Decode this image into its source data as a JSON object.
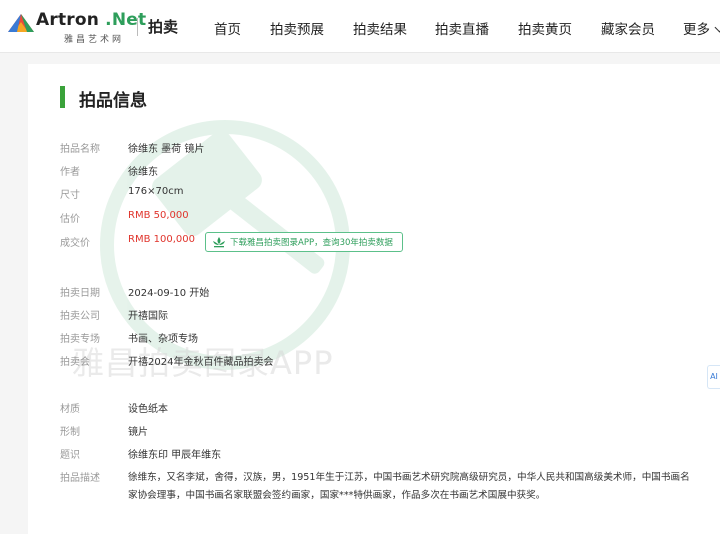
{
  "brand": {
    "name_prefix": "Artron",
    "name_suffix": ".Net",
    "sub": "雅昌艺术网",
    "accent": "#2e9e5b"
  },
  "section": "拍卖",
  "nav": [
    "首页",
    "拍卖预展",
    "拍卖结果",
    "拍卖直播",
    "拍卖黄页",
    "藏家会员",
    "更多"
  ],
  "heading": "拍品信息",
  "group1": [
    {
      "label": "拍品名称",
      "value": "徐维东 墨荷 镜片"
    },
    {
      "label": "作者",
      "value": "徐维东"
    },
    {
      "label": "尺寸",
      "value": "176×70cm"
    },
    {
      "label": "估价",
      "value": "RMB 50,000"
    },
    {
      "label": "成交价",
      "value": "RMB 100,000"
    }
  ],
  "app_promo": "下载雅昌拍卖图录APP，查询30年拍卖数据",
  "group2": [
    {
      "label": "拍卖日期",
      "value": "2024-09-10 开始"
    },
    {
      "label": "拍卖公司",
      "value": "开禧国际"
    },
    {
      "label": "拍卖专场",
      "value": "书画、杂项专场"
    },
    {
      "label": "拍卖会",
      "value": "开禧2024年金秋百件藏品拍卖会"
    }
  ],
  "group3": [
    {
      "label": "材质",
      "value": "设色纸本"
    },
    {
      "label": "形制",
      "value": "镜片"
    },
    {
      "label": "题识",
      "value": "徐维东印 甲辰年维东"
    },
    {
      "label": "拍品描述",
      "value": "徐维东，又名李斌，舍得，汉族，男，1951年生于江苏，中国书画艺术研究院高级研究员，中华人民共和国高级美术师，中国书画名家协会理事，中国书画名家联盟会签约画家，国家***特供画家，作品多次在书画艺术国展中获奖。"
    }
  ],
  "watermark_text": "雅昌拍卖图录APP",
  "side_tab": "AI",
  "colors": {
    "price_red": "#e0342c",
    "title_bar": "#3aa23a",
    "promo_green": "#2e9e5b"
  }
}
